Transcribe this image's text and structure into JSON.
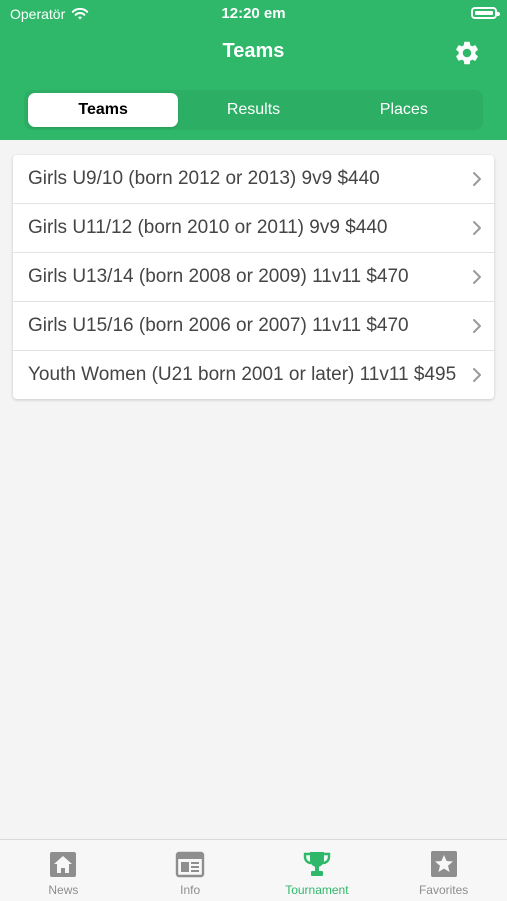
{
  "status_bar": {
    "carrier": "Operatör",
    "time": "12:20 em"
  },
  "header": {
    "title": "Teams",
    "settings_icon": "gear-icon"
  },
  "segments": [
    {
      "label": "Teams",
      "active": true
    },
    {
      "label": "Results",
      "active": false
    },
    {
      "label": "Places",
      "active": false
    }
  ],
  "teams": [
    {
      "label": "Girls U9/10 (born 2012 or 2013) 9v9 $440"
    },
    {
      "label": "Girls U11/12 (born 2010 or 2011) 9v9 $440"
    },
    {
      "label": "Girls U13/14 (born 2008 or 2009) 11v11 $470"
    },
    {
      "label": "Girls U15/16 (born 2006 or 2007) 11v11 $470"
    },
    {
      "label": "Youth Women (U21 born 2001 or later) 11v11 $495"
    }
  ],
  "tabbar": [
    {
      "label": "News",
      "icon": "house-icon",
      "active": false
    },
    {
      "label": "Info",
      "icon": "newspaper-icon",
      "active": false
    },
    {
      "label": "Tournament",
      "icon": "trophy-icon",
      "active": true
    },
    {
      "label": "Favorites",
      "icon": "star-icon",
      "active": false
    }
  ],
  "colors": {
    "accent": "#2fb86a",
    "inactive": "#8e8e8e"
  }
}
